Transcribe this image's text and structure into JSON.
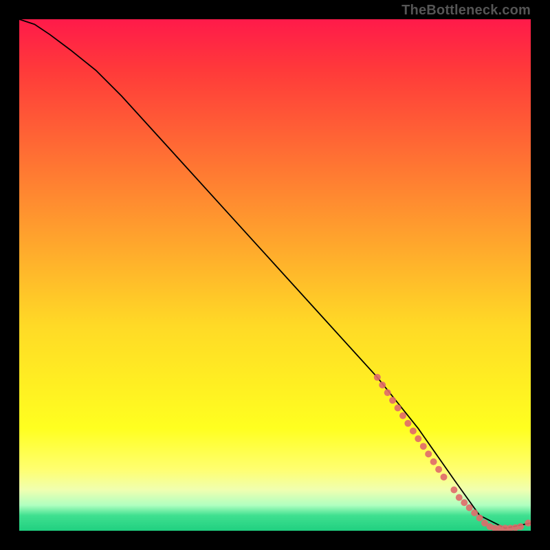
{
  "watermark": "TheBottleneck.com",
  "chart_data": {
    "type": "line",
    "title": "",
    "xlabel": "",
    "ylabel": "",
    "xlim": [
      0,
      100
    ],
    "ylim": [
      0,
      100
    ],
    "series": [
      {
        "name": "curve",
        "x": [
          0,
          3,
          6,
          10,
          15,
          20,
          30,
          40,
          50,
          60,
          70,
          78,
          85,
          90,
          95,
          100
        ],
        "y": [
          100,
          99,
          97,
          94,
          90,
          85,
          74,
          63,
          52,
          41,
          30,
          20,
          10,
          3,
          0.5,
          1.5
        ]
      }
    ],
    "markers": {
      "name": "highlight-points",
      "color": "#e06a6a",
      "x": [
        70,
        71,
        72,
        73,
        74,
        75,
        76,
        77,
        78,
        79,
        80,
        81,
        82,
        83,
        85,
        86,
        87,
        88,
        89,
        90,
        91,
        92,
        93,
        94,
        95,
        96,
        97,
        98,
        99.5
      ],
      "y": [
        30,
        28.5,
        27,
        25.5,
        24,
        22.5,
        21,
        19.5,
        18,
        16.5,
        15,
        13.5,
        12,
        10.5,
        8,
        6.5,
        5.5,
        4.5,
        3.5,
        2.5,
        1.5,
        0.8,
        0.5,
        0.5,
        0.5,
        0.5,
        0.6,
        0.8,
        1.5
      ]
    }
  }
}
